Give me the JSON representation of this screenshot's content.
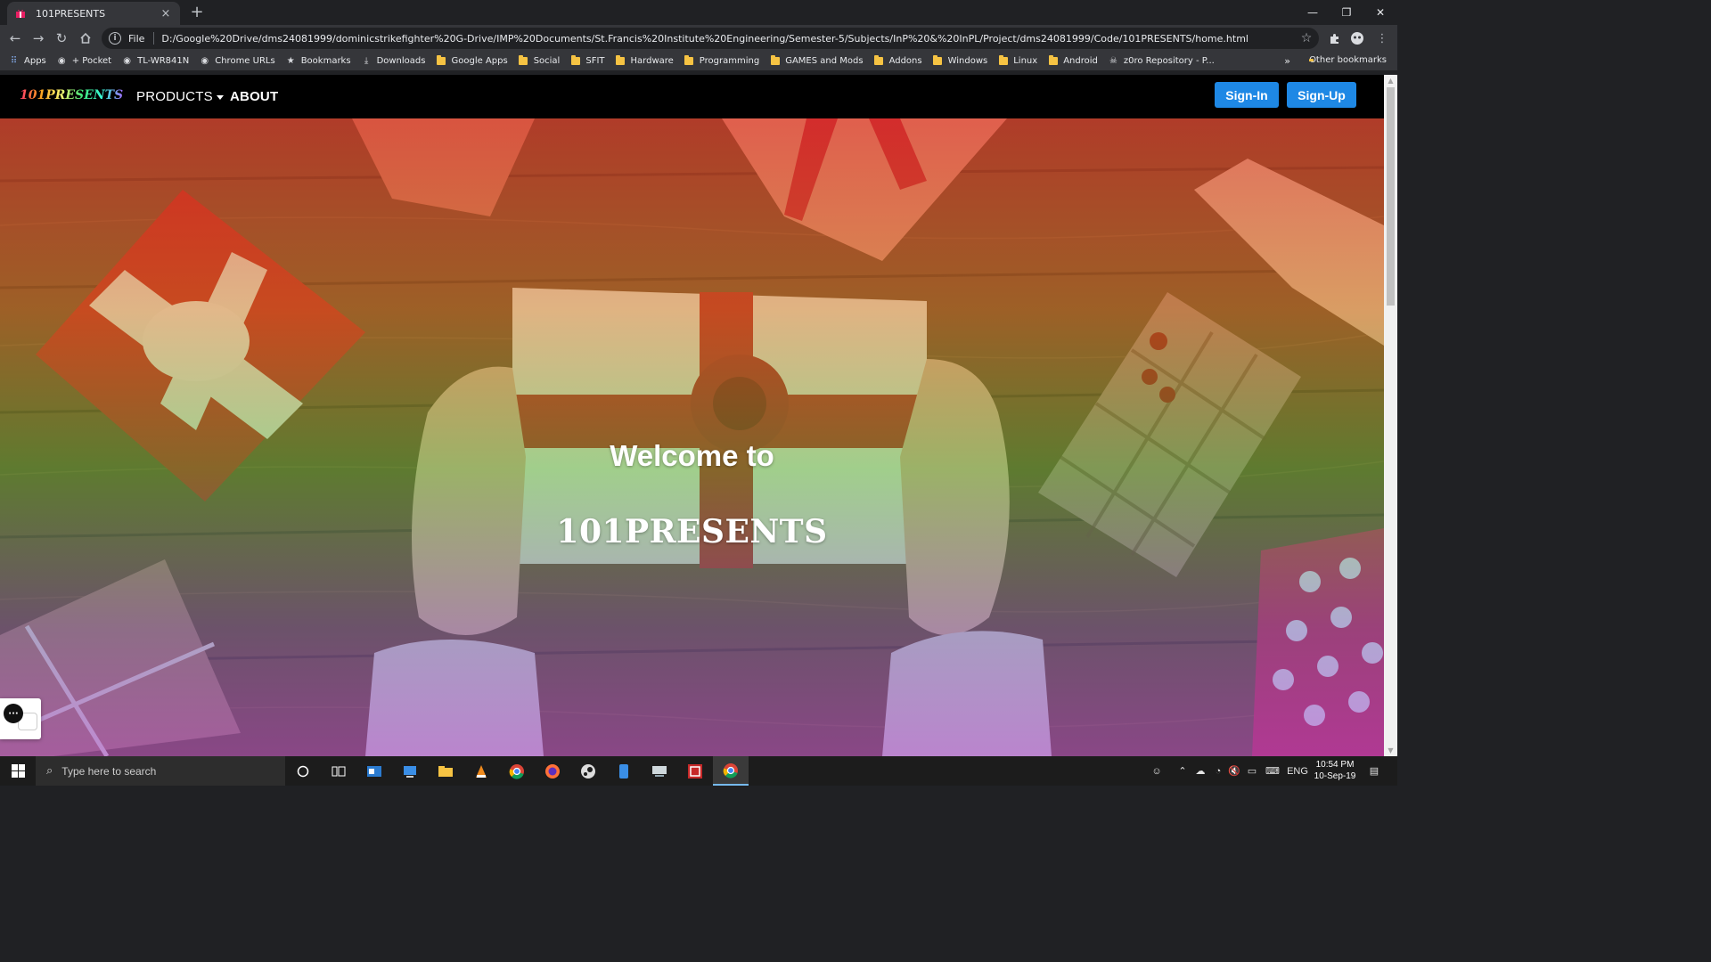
{
  "browser": {
    "tab_title": "101PRESENTS",
    "tab_close": "×",
    "new_tab": "+",
    "window_controls": {
      "minimize": "—",
      "restore": "❐",
      "close": "✕"
    },
    "omnibox": {
      "scheme": "File",
      "url": "D:/Google%20Drive/dms24081999/dominicstrikefighter%20G-Drive/IMP%20Documents/St.Francis%20Institute%20Engineering/Semester-5/Subjects/InP%20&%20InPL/Project/dms24081999/Code/101PRESENTS/home.html"
    },
    "bookmarks": [
      {
        "label": "Apps",
        "icon": "apps-grid-icon"
      },
      {
        "label": "+ Pocket",
        "icon": "globe-icon"
      },
      {
        "label": "TL-WR841N",
        "icon": "globe-icon"
      },
      {
        "label": "Chrome URLs",
        "icon": "globe-icon"
      },
      {
        "label": "Bookmarks",
        "icon": "star-icon"
      },
      {
        "label": "Downloads",
        "icon": "download-icon"
      },
      {
        "label": "Google Apps",
        "icon": "folder-icon"
      },
      {
        "label": "Social",
        "icon": "folder-icon"
      },
      {
        "label": "SFIT",
        "icon": "folder-icon"
      },
      {
        "label": "Hardware",
        "icon": "folder-icon"
      },
      {
        "label": "Programming",
        "icon": "folder-icon"
      },
      {
        "label": "GAMES and Mods",
        "icon": "folder-icon"
      },
      {
        "label": "Addons",
        "icon": "folder-icon"
      },
      {
        "label": "Windows",
        "icon": "folder-icon"
      },
      {
        "label": "Linux",
        "icon": "folder-icon"
      },
      {
        "label": "Android",
        "icon": "folder-icon"
      },
      {
        "label": "z0ro Repository - P...",
        "icon": "skull-icon"
      }
    ],
    "bookmarks_more": "»",
    "other_bookmarks": "Other bookmarks"
  },
  "site": {
    "logo_text": "101PRESENTS",
    "nav": {
      "products": "PRODUCTS",
      "about": "ABOUT"
    },
    "buttons": {
      "signin": "Sign-In",
      "signup": "Sign-Up"
    },
    "hero": {
      "welcome": "Welcome to",
      "brand": "101PRESENTS"
    }
  },
  "taskbar": {
    "search_placeholder": "Type here to search",
    "language": "ENG",
    "time": "10:54 PM",
    "date": "10-Sep-19"
  }
}
